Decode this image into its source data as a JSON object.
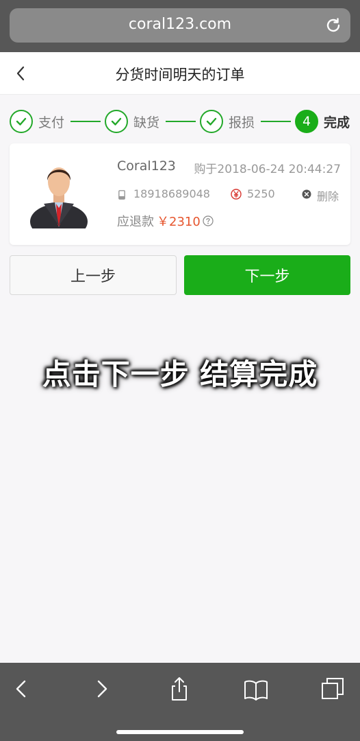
{
  "browser": {
    "url": "coral123.com",
    "reload_icon": "reload-icon"
  },
  "header": {
    "title": "分货时间明天的订单",
    "back_icon": "chevron-left-icon"
  },
  "steps": [
    {
      "label": "支付",
      "state": "done"
    },
    {
      "label": "缺货",
      "state": "done"
    },
    {
      "label": "报损",
      "state": "done"
    },
    {
      "label": "完成",
      "state": "active",
      "number": "4"
    }
  ],
  "order": {
    "user_name": "Coral123",
    "purchase_time": "购于2018-06-24 20:44:27",
    "phone": "18918689048",
    "amount": "5250",
    "delete_label": "删除",
    "refund_label": "应退款",
    "refund_amount": "￥2310"
  },
  "buttons": {
    "prev_label": "上一步",
    "next_label": "下一步"
  },
  "caption": "点击下一步  结算完成",
  "colors": {
    "accent_green": "#1aad19",
    "refund_red": "#e6562f",
    "browser_chrome": "#575757"
  }
}
